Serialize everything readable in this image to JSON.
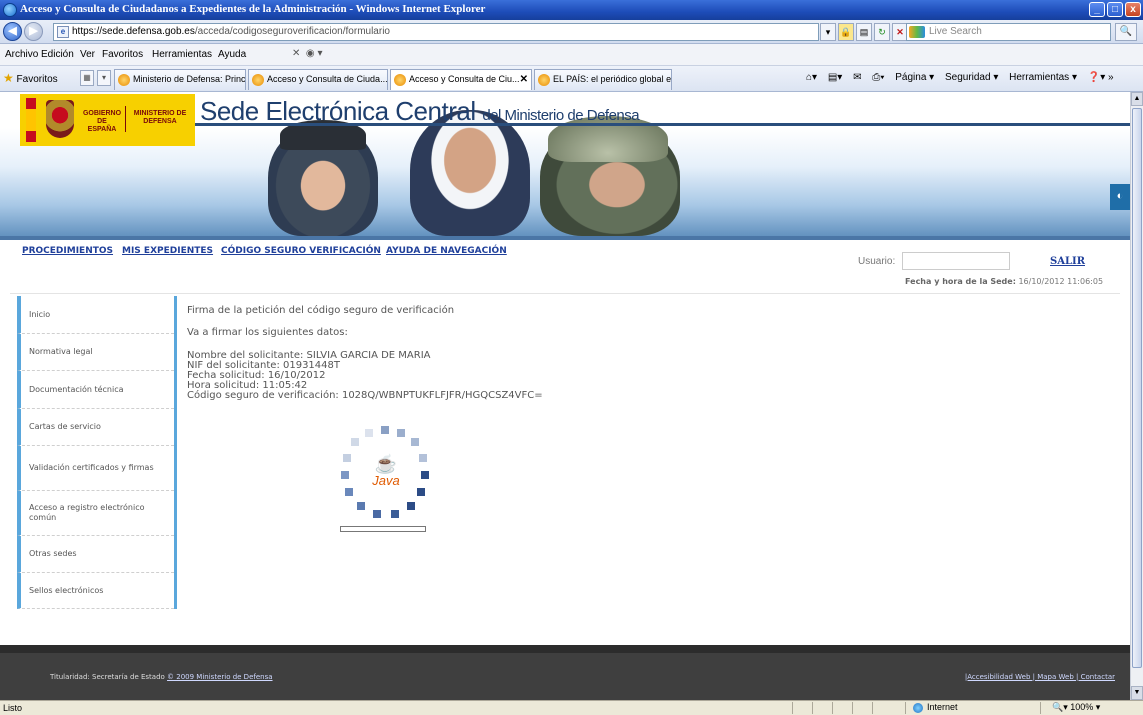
{
  "window": {
    "title": "Acceso y Consulta de Ciudadanos a Expedientes de la Administración - Windows Internet Explorer",
    "min": "_",
    "max": "□",
    "close": "x"
  },
  "address": {
    "host": "https://sede.defensa.gob.es",
    "path": "/acceda/codigoseguroverificacion/formulario",
    "search_placeholder": "Live Search"
  },
  "menu": [
    "Archivo",
    "Edición",
    "Ver",
    "Favoritos",
    "Herramientas",
    "Ayuda"
  ],
  "favorites": {
    "label": "Favoritos",
    "tabs": [
      {
        "label": "Ministerio de Defensa: Principal"
      },
      {
        "label": "Acceso y Consulta de Ciuda..."
      },
      {
        "label": "Acceso y Consulta de Ciu..."
      },
      {
        "label": "EL PAÍS: el periódico global e..."
      }
    ],
    "commands": [
      "Página ▾",
      "Seguridad ▾",
      "Herramientas ▾"
    ]
  },
  "header": {
    "gobierno": "GOBIERNO DE ESPAÑA",
    "ministerio": "MINISTERIO DE DEFENSA",
    "title_main": "Sede Electrónica Central",
    "title_small": "del Ministerio de Defensa"
  },
  "nav": {
    "links": [
      "PROCEDIMIENTOS",
      "MIS EXPEDIENTES",
      "CÓDIGO SEGURO VERIFICACIÓN",
      "AYUDA DE NAVEGACIÓN"
    ],
    "user_label": "Usuario:",
    "logout": "SALIR",
    "date_label": "Fecha y hora de la Sede:",
    "date_value": "16/10/2012 11:06:05"
  },
  "sidebar": [
    "Inicio",
    "Normativa legal",
    "Documentación técnica",
    "Cartas de servicio",
    "Validación certificados y firmas",
    "Acceso a registro electrónico común",
    "Otras sedes",
    "Sellos electrónicos"
  ],
  "content": {
    "title": "Firma de la petición del código seguro de verificación",
    "subtitle": "Va a firmar los siguientes datos:",
    "lines": [
      "Nombre del solicitante: SILVIA  GARCIA  DE MARIA",
      "NIF del solicitante: 01931448T",
      "Fecha solicitud: 16/10/2012",
      "Hora solicitud: 11:05:42",
      "Código seguro de verificación: 1028Q/WBNPTUKFLFJFR/HGQCSZ4VFC="
    ],
    "java_label": "Java"
  },
  "footer": {
    "left_prefix": "Titularidad: Secretaría de Estado",
    "left_link": "© 2009 Ministerio de Defensa",
    "right": "|Accesibilidad Web | Mapa Web | Contactar"
  },
  "status": {
    "text": "Listo",
    "zone": "Internet",
    "zoom": "100%"
  },
  "colors": {
    "accent": "#5aa7dc",
    "link": "#1f3f9a",
    "footer": "#3f3f3f"
  }
}
